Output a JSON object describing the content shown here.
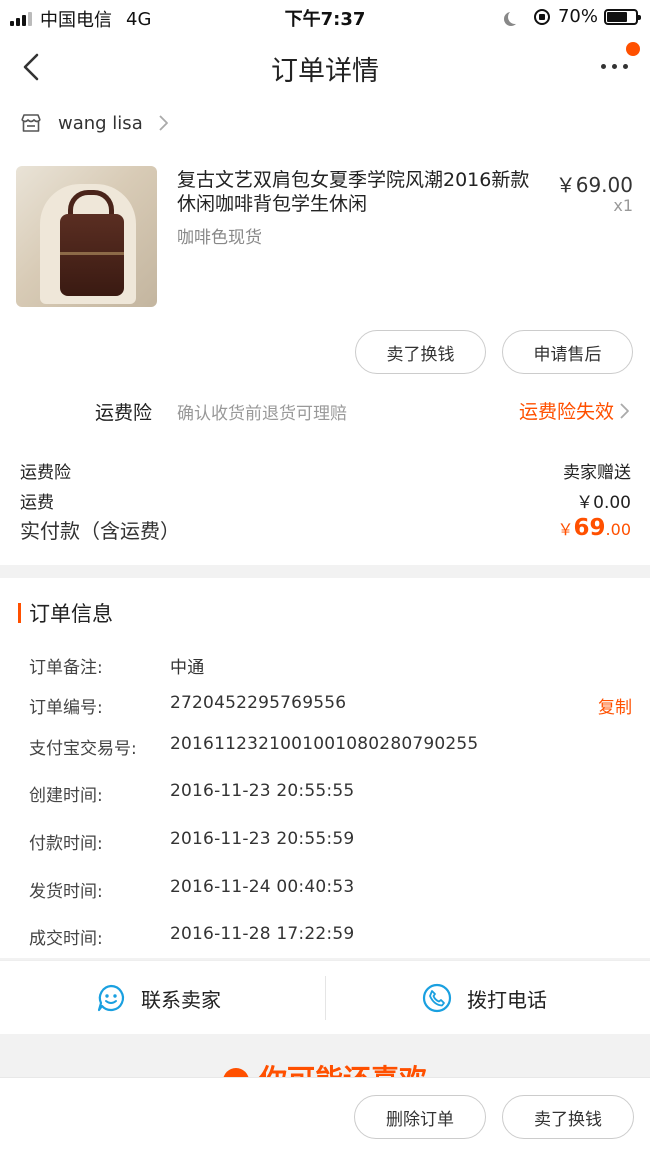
{
  "status_bar": {
    "carrier": "中国电信",
    "network": "4G",
    "time": "下午7:37",
    "battery_text": "70%",
    "battery_level": 0.7
  },
  "nav": {
    "title": "订单详情",
    "back_icon": "chevron-left-icon",
    "more_icon": "more-dots-icon",
    "notify_color": "#ff5000"
  },
  "shop": {
    "name": "wang lisa",
    "icon": "store-icon"
  },
  "item": {
    "title": "复古文艺双肩包女夏季学院风潮2016新款休闲咖啡背包学生休闲",
    "sku": "咖啡色现货",
    "price": "￥69.00",
    "qty": "x1"
  },
  "item_actions": {
    "sell": "卖了换钱",
    "after_sale": "申请售后"
  },
  "insurance": {
    "label": "运费险",
    "desc": "确认收货前退货可理赔",
    "status": "运费险失效"
  },
  "fees": {
    "insurance_label": "运费险",
    "insurance_value": "卖家赠送",
    "shipping_label": "运费",
    "shipping_value": "￥0.00",
    "paid_label": "实付款（含运费）",
    "paid_currency": "￥",
    "paid_int": "69",
    "paid_dec": ".00"
  },
  "order_info": {
    "title": "订单信息",
    "rows": [
      {
        "label": "订单备注:",
        "value": "中通"
      },
      {
        "label": "订单编号:",
        "value": "2720452295769556"
      },
      {
        "label": "支付宝交易号:",
        "value": "2016112321001001080280790255"
      },
      {
        "label": "创建时间:",
        "value": "2016-11-23 20:55:55"
      },
      {
        "label": "付款时间:",
        "value": "2016-11-23 20:55:59"
      },
      {
        "label": "发货时间:",
        "value": "2016-11-24 00:40:53"
      },
      {
        "label": "成交时间:",
        "value": "2016-11-28 17:22:59"
      }
    ],
    "copy": "复制"
  },
  "contact": {
    "seller": "联系卖家",
    "call": "拨打电话",
    "accent": "#1aa0e0"
  },
  "recommend": {
    "title": "你可能还喜欢"
  },
  "bottom": {
    "delete": "删除订单",
    "sell": "卖了换钱"
  },
  "colors": {
    "accent": "#ff5000"
  }
}
